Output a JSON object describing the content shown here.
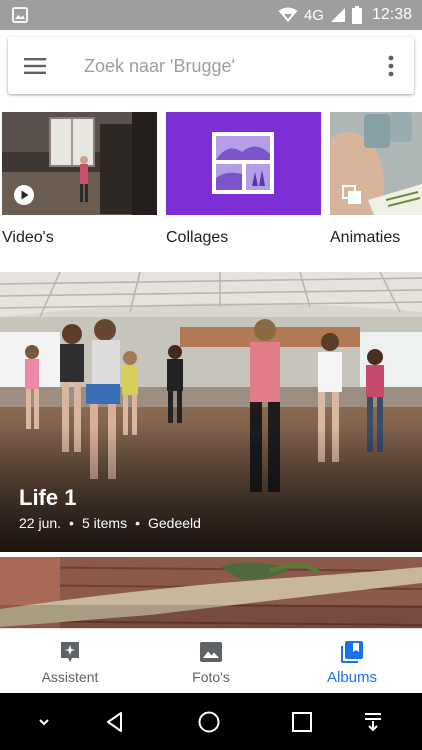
{
  "status_bar": {
    "network": "4G",
    "time": "12:38"
  },
  "search": {
    "placeholder": "Zoek naar 'Brugge'"
  },
  "tiles": [
    {
      "label": "Video's"
    },
    {
      "label": "Collages"
    },
    {
      "label": "Animaties"
    }
  ],
  "album": {
    "title": "Life 1",
    "date": "22 jun.",
    "count": "5 items",
    "shared": "Gedeeld"
  },
  "bottom_nav": {
    "items": [
      {
        "label": "Assistent",
        "icon": "assistant-icon"
      },
      {
        "label": "Foto's",
        "icon": "photos-icon"
      },
      {
        "label": "Albums",
        "icon": "albums-icon",
        "active": true
      }
    ],
    "active_color": "#1a73e8"
  },
  "system_nav": {
    "buttons": [
      "chevron-down-icon",
      "back-icon",
      "home-icon",
      "recents-icon",
      "download-icon"
    ]
  }
}
